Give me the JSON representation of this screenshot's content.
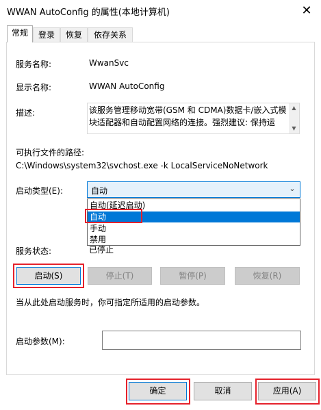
{
  "window": {
    "title": "WWAN AutoConfig 的属性(本地计算机)",
    "close_glyph": "✕"
  },
  "tabs": [
    {
      "label": "常规",
      "active": true
    },
    {
      "label": "登录",
      "active": false
    },
    {
      "label": "恢复",
      "active": false
    },
    {
      "label": "依存关系",
      "active": false
    }
  ],
  "general": {
    "service_name_label": "服务名称:",
    "service_name_value": "WwanSvc",
    "display_name_label": "显示名称:",
    "display_name_value": "WWAN AutoConfig",
    "description_label": "描述:",
    "description_value": "该服务管理移动宽带(GSM 和 CDMA)数据卡/嵌入式模块适配器和自动配置网络的连接。强烈建议: 保持运",
    "exe_path_label": "可执行文件的路径:",
    "exe_path_value": "C:\\Windows\\system32\\svchost.exe -k LocalServiceNoNetwork",
    "startup_type_label": "启动类型(E):",
    "startup_type_value": "自动",
    "startup_options": [
      "自动(延迟启动)",
      "自动",
      "手动",
      "禁用"
    ],
    "startup_selected_index": 1,
    "service_status_label": "服务状态:",
    "service_status_value": "已停止",
    "hint_text": "当从此处启动服务时，你可指定所适用的启动参数。",
    "start_params_label": "启动参数(M):",
    "start_params_value": ""
  },
  "service_buttons": {
    "start": "启动(S)",
    "stop": "停止(T)",
    "pause": "暂停(P)",
    "resume": "恢复(R)"
  },
  "footer_buttons": {
    "ok": "确定",
    "cancel": "取消",
    "apply": "应用(A)"
  },
  "colors": {
    "highlight": "#0078d7",
    "annotation_red": "#e5212b"
  }
}
